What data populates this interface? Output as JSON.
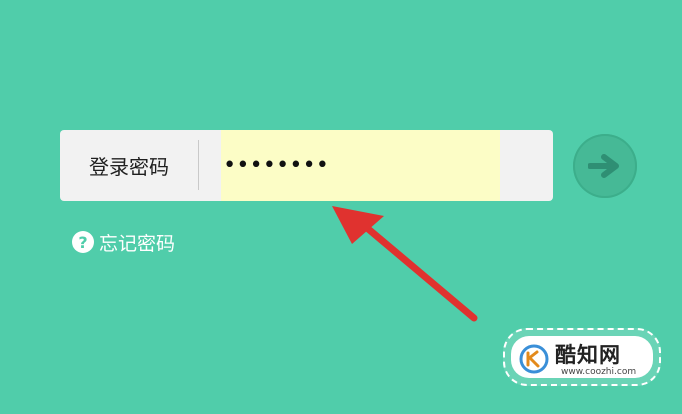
{
  "login": {
    "label": "登录密码",
    "password_value": "••••••••"
  },
  "forgot": {
    "icon": "question-circle-icon",
    "label": "忘记密码"
  },
  "submit": {
    "icon": "arrow-right-icon"
  },
  "annotation": {
    "icon": "red-arrow-pointer",
    "color": "#e0322f"
  },
  "watermark": {
    "name": "酷知网",
    "url": "www.coozhi.com"
  },
  "colors": {
    "background": "#50cdaa",
    "input_bg": "#fcfdc6",
    "box_bg": "#f2f2f2",
    "button_bg": "#46b996"
  }
}
